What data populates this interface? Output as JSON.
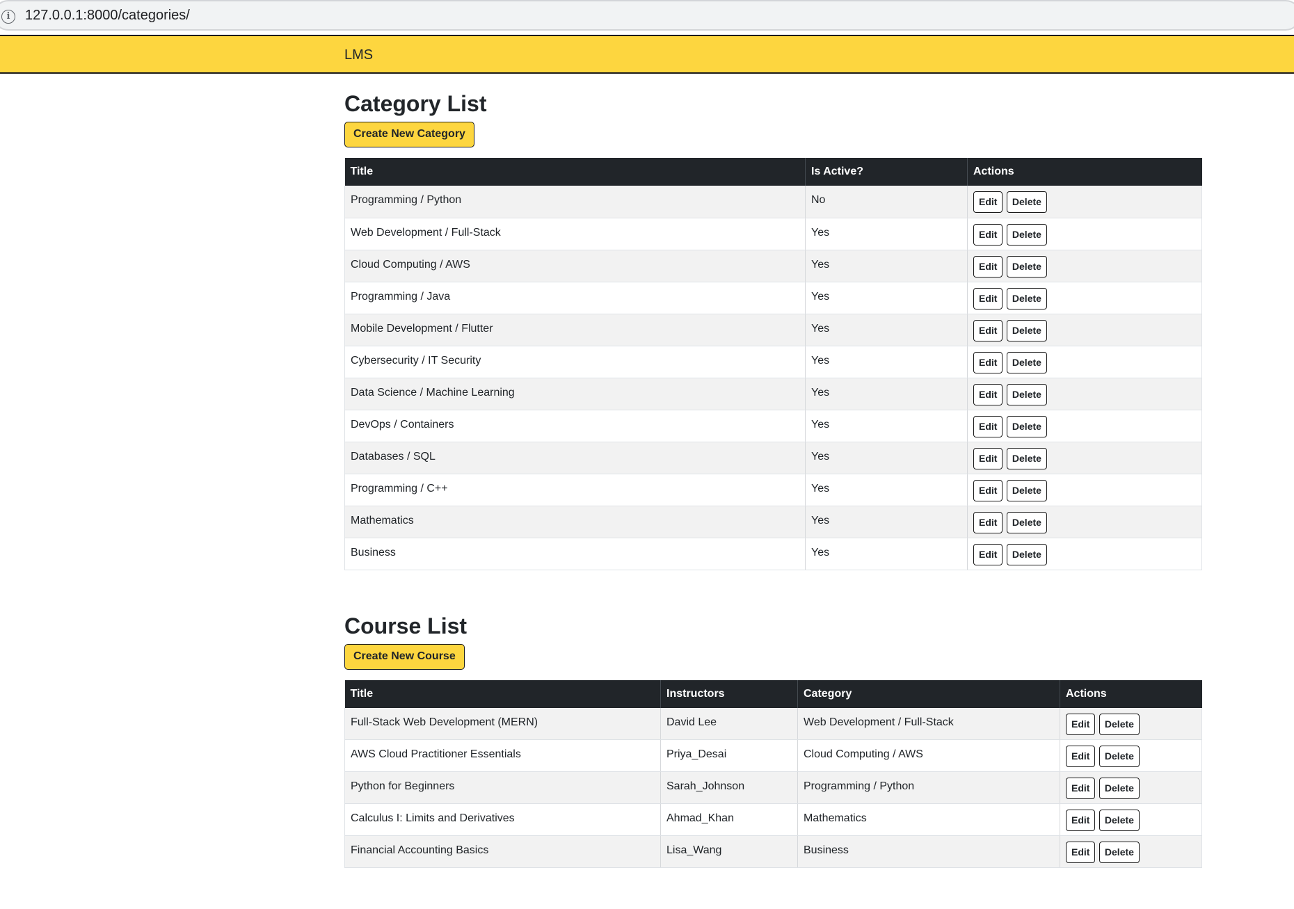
{
  "browser": {
    "url": "127.0.0.1:8000/categories/",
    "info_icon": "info-icon"
  },
  "navbar": {
    "brand": "LMS"
  },
  "categories": {
    "title": "Category List",
    "create_label": "Create New Category",
    "headers": [
      "Title",
      "Is Active?",
      "Actions"
    ],
    "rows": [
      {
        "title": "Programming / Python",
        "active": "No"
      },
      {
        "title": "Web Development / Full-Stack",
        "active": "Yes"
      },
      {
        "title": "Cloud Computing / AWS",
        "active": "Yes"
      },
      {
        "title": "Programming / Java",
        "active": "Yes"
      },
      {
        "title": "Mobile Development / Flutter",
        "active": "Yes"
      },
      {
        "title": "Cybersecurity / IT Security",
        "active": "Yes"
      },
      {
        "title": "Data Science / Machine Learning",
        "active": "Yes"
      },
      {
        "title": "DevOps / Containers",
        "active": "Yes"
      },
      {
        "title": "Databases / SQL",
        "active": "Yes"
      },
      {
        "title": "Programming / C++",
        "active": "Yes"
      },
      {
        "title": "Mathematics",
        "active": "Yes"
      },
      {
        "title": "Business",
        "active": "Yes"
      }
    ]
  },
  "courses": {
    "title": "Course List",
    "create_label": "Create New Course",
    "headers": [
      "Title",
      "Instructors",
      "Category",
      "Actions"
    ],
    "rows": [
      {
        "title": "Full-Stack Web Development (MERN)",
        "instructor": "David Lee",
        "category": "Web Development / Full-Stack"
      },
      {
        "title": "AWS Cloud Practitioner Essentials",
        "instructor": "Priya_Desai",
        "category": "Cloud Computing / AWS"
      },
      {
        "title": "Python for Beginners",
        "instructor": "Sarah_Johnson",
        "category": "Programming / Python"
      },
      {
        "title": "Calculus I: Limits and Derivatives",
        "instructor": "Ahmad_Khan",
        "category": "Mathematics"
      },
      {
        "title": "Financial Accounting Basics",
        "instructor": "Lisa_Wang",
        "category": "Business"
      }
    ]
  },
  "actions": {
    "edit_label": "Edit",
    "delete_label": "Delete"
  },
  "colors": {
    "accent": "#fdd63f",
    "header_bg": "#212529",
    "stripe": "#f2f2f2"
  }
}
